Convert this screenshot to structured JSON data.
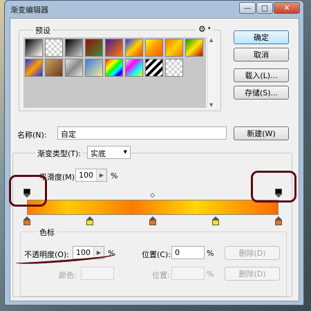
{
  "window": {
    "title": "渐变编辑器",
    "minimize": "—",
    "maximize": "□",
    "close": "✕"
  },
  "presets": {
    "label": "预设",
    "gear": "⚙",
    "swatches": [
      "linear-gradient(135deg,#000,#fff)",
      "conic-gradient(#d0d0d0 25%,#fff 0 50%,#d0d0d0 0 75%,#fff 0) 0 0/8px 8px",
      "linear-gradient(135deg,#000,#d0d0d0)",
      "linear-gradient(135deg,#9b0f10,#3a8f2e)",
      "linear-gradient(135deg,#4b1c8c,#ff7a00)",
      "linear-gradient(135deg,#1e3aff,#ffd000,#ff3d00)",
      "linear-gradient(135deg,#ff0,#ff9800,#ff5200)",
      "linear-gradient(135deg,#ff7300,#ffd200,#ff7300)",
      "linear-gradient(135deg,#1c9900,#ffe600,#c80000)",
      "linear-gradient(135deg,#1d2ff0,#ffa000,#1d2ff0)",
      "linear-gradient(135deg,#c8a062,#6d3a1a)",
      "linear-gradient(135deg,#e8e8e8,#8a8a8a,#e8e8e8)",
      "linear-gradient(135deg,#3b7bd8,#f5e99c)",
      "linear-gradient(135deg,red,orange,yellow,lime,cyan,blue,magenta)",
      "linear-gradient(135deg,#c0ffc0,#ff00ff,#00ffff,#ffff00)",
      "repeating-linear-gradient(135deg,#000 0 4px,#fff 4px 8px)",
      "conic-gradient(#d0d0d0 25%,#fff 0 50%,#d0d0d0 0 75%,#fff 0) 0 0/8px 8px"
    ]
  },
  "buttons": {
    "ok": "确定",
    "cancel": "取消",
    "load": "载入(L)...",
    "save": "存储(S)...",
    "new": "新建(W)"
  },
  "name": {
    "label": "名称(N):",
    "value": "自定"
  },
  "gradient": {
    "type_label": "渐变类型(T):",
    "type_value": "实底",
    "smooth_label": "平滑度(M):",
    "smoothness": "100",
    "unit": "%",
    "bar_fill": "linear-gradient(to right,#ff7a00 0%,#ffcc00 16%,#ff7a00 42%,#ffd800 67%,#ff6a00 100%)",
    "color_stop_colors": [
      "#e8721c",
      "#f5e12a",
      "#e8721c",
      "#f5e12a",
      "#e8721c"
    ],
    "color_stop_positions": [
      0,
      0.25,
      0.5,
      0.75,
      1
    ],
    "opacity_stop_positions": [
      0,
      1
    ],
    "midpoint": "◇"
  },
  "stops": {
    "section_label": "色标",
    "opacity_label": "不透明度(O):",
    "opacity_value": "100",
    "unit": "%",
    "location_label": "位置(C):",
    "location_value": "0",
    "delete_label": "删除(D)",
    "color_label": "颜色:",
    "color_location_label": "位置:"
  }
}
